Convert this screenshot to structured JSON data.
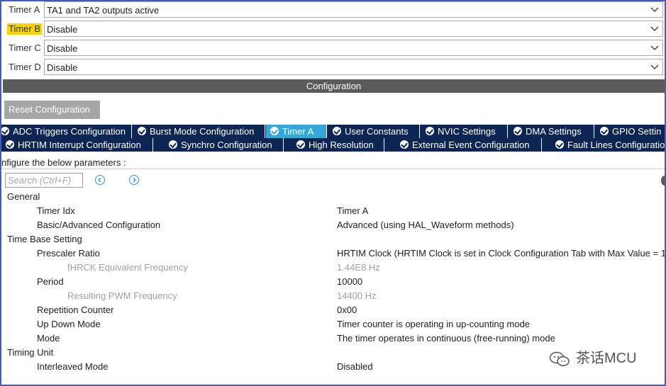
{
  "timers": [
    {
      "label": "Timer A",
      "value": "TA1 and TA2 outputs active",
      "highlight": false
    },
    {
      "label": "Timer B",
      "value": "Disable",
      "highlight": true
    },
    {
      "label": "Timer C",
      "value": "Disable",
      "highlight": false
    },
    {
      "label": "Timer D",
      "value": "Disable",
      "highlight": false
    }
  ],
  "config_bar": "Configuration",
  "reset_button": "Reset Configuration",
  "tabs_row1": [
    {
      "label": "ADC Triggers Configuration",
      "active": false
    },
    {
      "label": "Burst Mode Configuration",
      "active": false
    },
    {
      "label": "Timer A",
      "active": true
    },
    {
      "label": "User Constants",
      "active": false
    },
    {
      "label": "NVIC Settings",
      "active": false
    },
    {
      "label": "DMA Settings",
      "active": false
    },
    {
      "label": "GPIO Settin",
      "active": false
    }
  ],
  "tabs_row2": [
    {
      "label": "HRTIM Interrupt Configuration",
      "active": false
    },
    {
      "label": "Synchro Configuration",
      "active": false
    },
    {
      "label": "High Resolution",
      "active": false
    },
    {
      "label": "External Event Configuration",
      "active": false
    },
    {
      "label": "Fault Lines Configuratio",
      "active": false
    }
  ],
  "instructions": "nfigure the below parameters :",
  "search": {
    "placeholder": "Search (Ctrl+F)"
  },
  "parameters": [
    {
      "name": "General",
      "value": "",
      "level": 0,
      "disabled": false
    },
    {
      "name": "Timer Idx",
      "value": "Timer A",
      "level": 1,
      "disabled": false
    },
    {
      "name": "Basic/Advanced Configuration",
      "value": "Advanced (using HAL_Waveform methods)",
      "level": 1,
      "disabled": false
    },
    {
      "name": "Time Base Setting",
      "value": "",
      "level": 0,
      "disabled": false
    },
    {
      "name": "Prescaler Ratio",
      "value": "HRTIM Clock (HRTIM Clock is set in Clock Configuration Tab with Max Value = 1",
      "level": 1,
      "disabled": false
    },
    {
      "name": "fHRCK Equivalent Frequency",
      "value": "1.44E8 Hz",
      "level": 2,
      "disabled": true
    },
    {
      "name": "Period",
      "value": "10000",
      "level": 1,
      "disabled": false
    },
    {
      "name": "Resulting PWM Frequency",
      "value": "14400 Hz",
      "level": 2,
      "disabled": true
    },
    {
      "name": "Repetition Counter",
      "value": "0x00",
      "level": 1,
      "disabled": false
    },
    {
      "name": "Up Down Mode",
      "value": "Timer counter is operating in up-counting mode",
      "level": 1,
      "disabled": false
    },
    {
      "name": "Mode",
      "value": "The timer operates in continuous (free-running) mode",
      "level": 1,
      "disabled": false
    },
    {
      "name": "Timing Unit",
      "value": "",
      "level": 0,
      "disabled": false
    },
    {
      "name": "Interleaved Mode",
      "value": "Disabled",
      "level": 1,
      "disabled": false
    }
  ],
  "watermark": "茶话MCU",
  "colors": {
    "tab_bg": "#0c2552",
    "tab_active": "#35a7d8",
    "highlight": "#f6d400",
    "config_bar": "#5b5b5b"
  }
}
